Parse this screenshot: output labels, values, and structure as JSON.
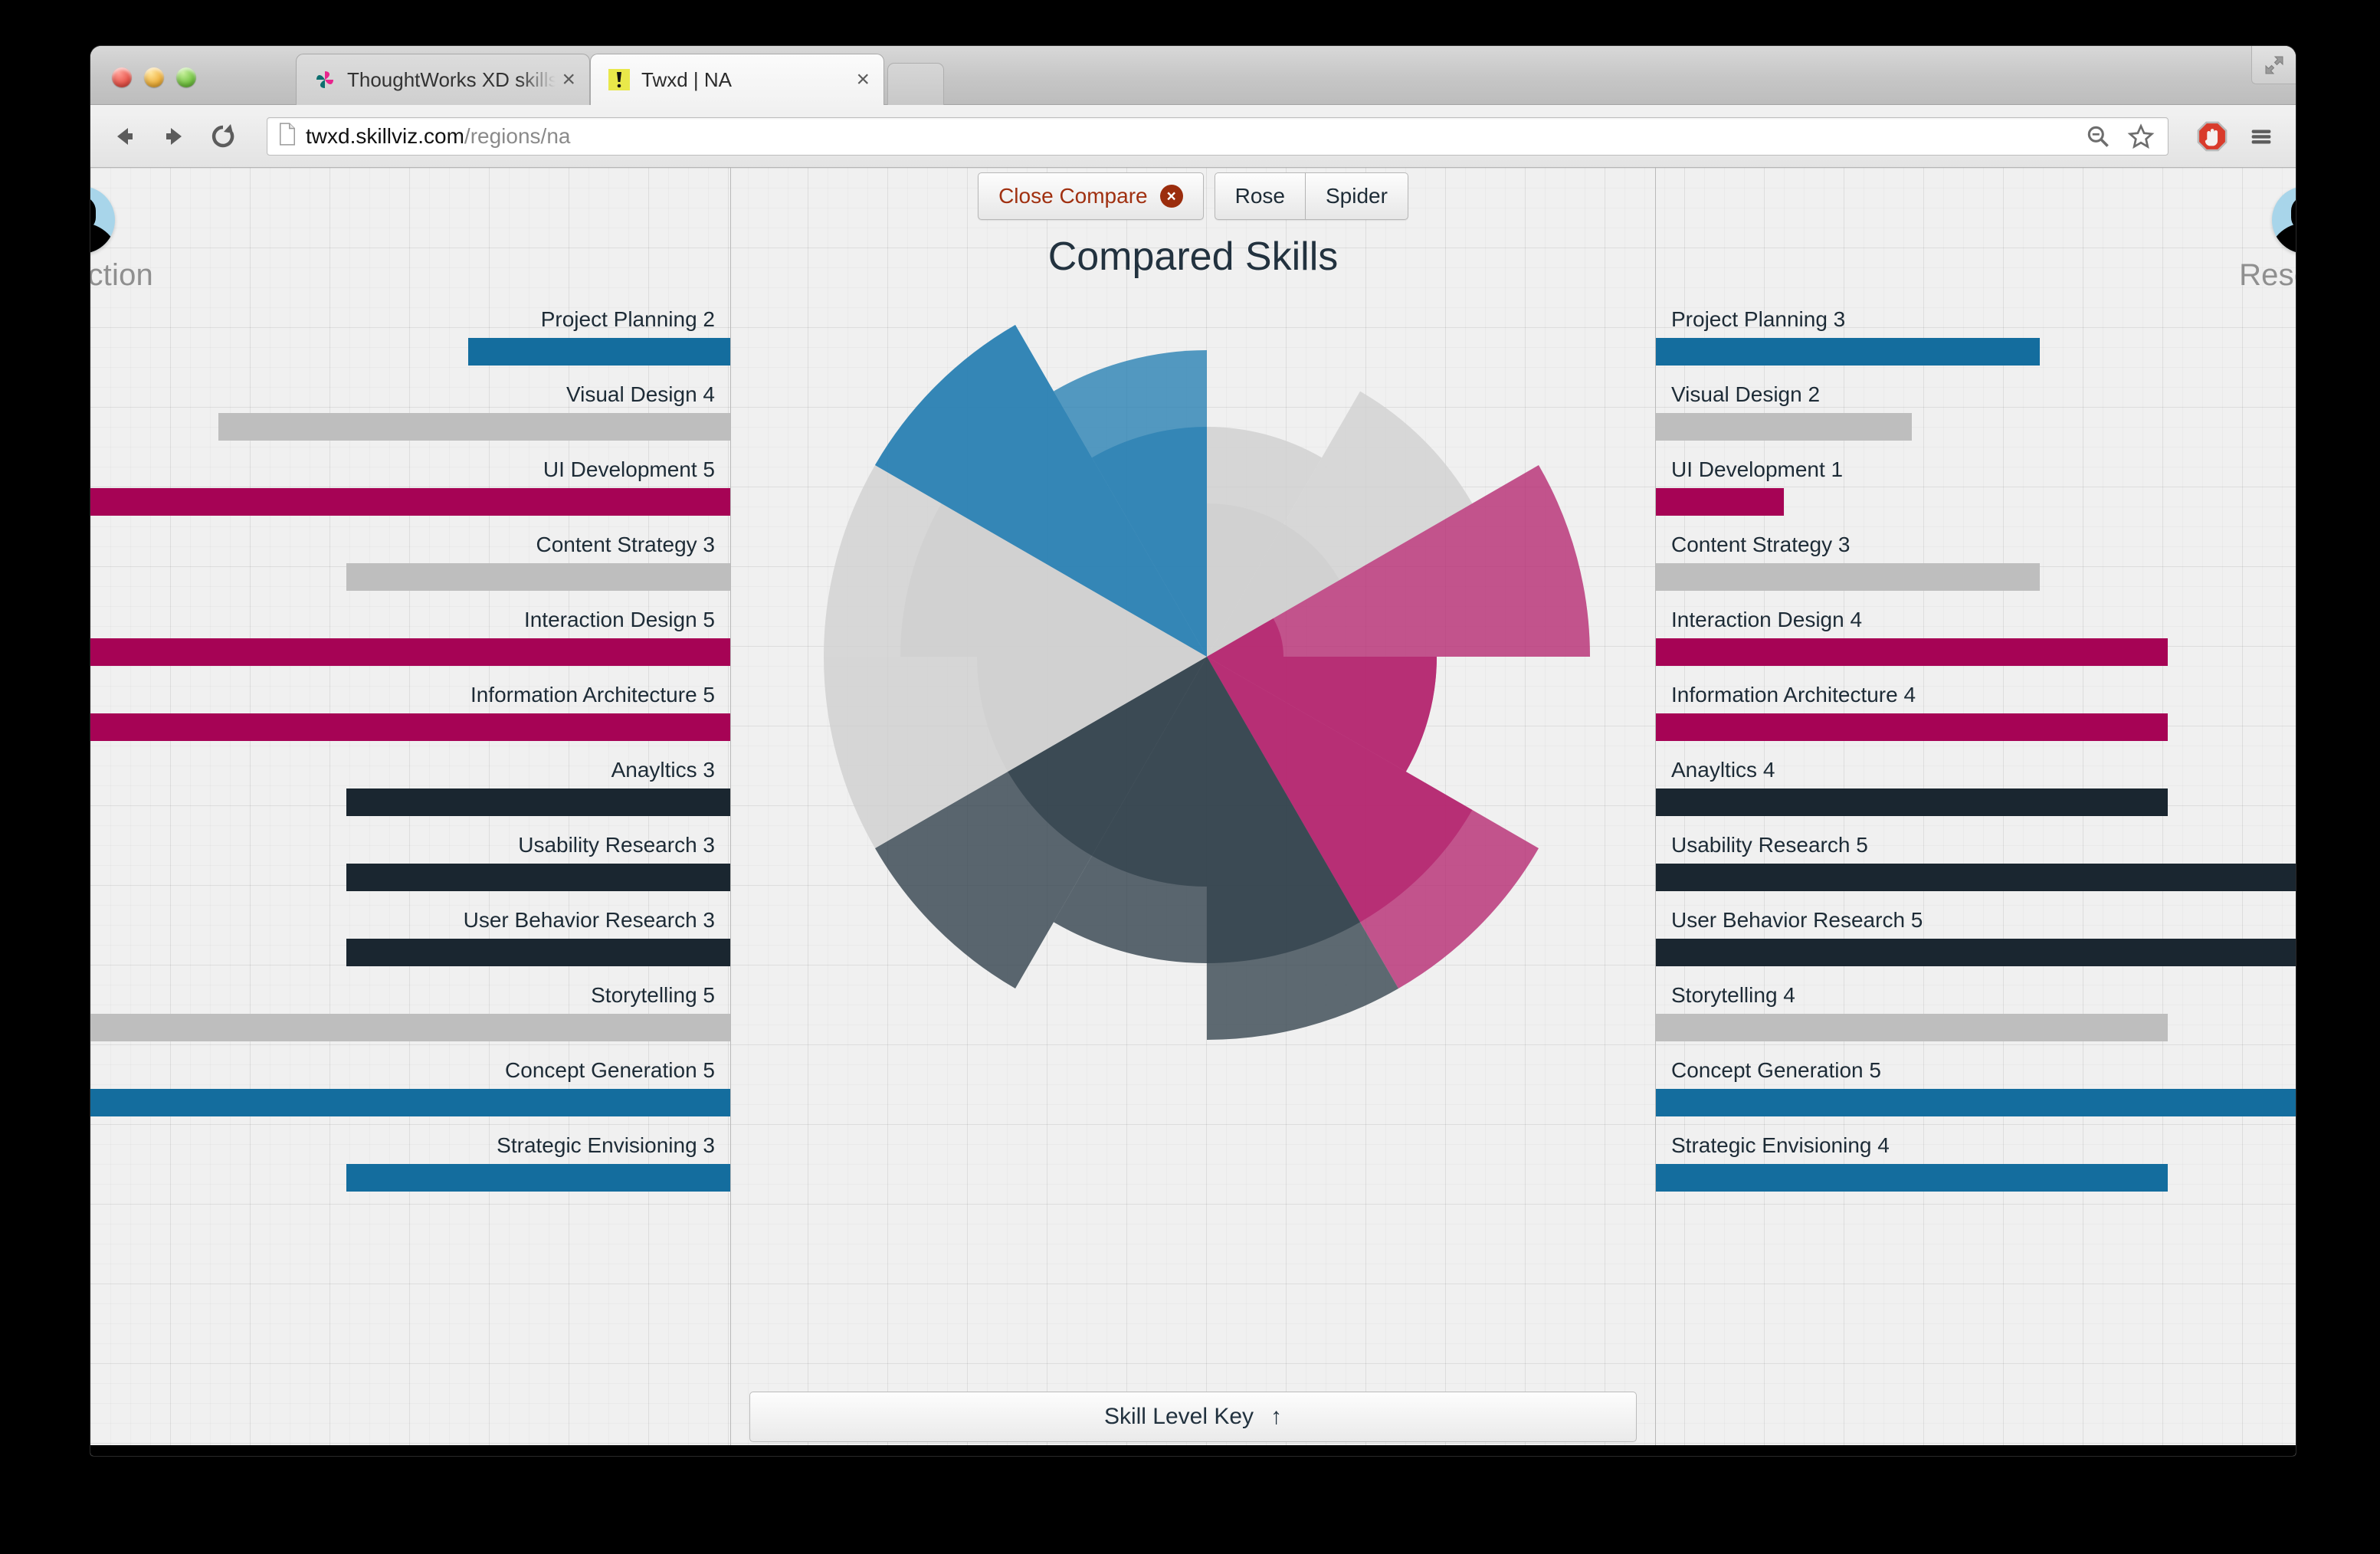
{
  "browser": {
    "tabs": [
      {
        "title": "ThoughtWorks XD skills vis",
        "favicon": "pinwheel-icon",
        "active": false,
        "close_label": "×"
      },
      {
        "title": "Twxd | NA",
        "favicon": "warning-icon",
        "active": true,
        "close_label": "×"
      }
    ],
    "new_tab_label": "",
    "nav": {
      "back": "←",
      "forward": "→",
      "reload": "⟳"
    },
    "url": {
      "domain": "twxd.skillviz.com",
      "path": "/regions/na"
    },
    "toolbar_icons": [
      "zoom-out-icon",
      "bookmark-star-icon",
      "adblock-icon",
      "chrome-menu-icon"
    ],
    "window_buttons": [
      "close",
      "minimize",
      "zoom"
    ],
    "maximize_label": "maximize-icon"
  },
  "center": {
    "close_compare_label": "Close Compare",
    "close_compare_badge": "×",
    "view_toggle": [
      {
        "label": "Rose",
        "selected": true
      },
      {
        "label": "Spider",
        "selected": false
      }
    ],
    "title": "Compared Skills",
    "skill_key_label": "Skill Level Key",
    "skill_key_arrow": "↑"
  },
  "colors": {
    "blue": "#146d9e",
    "magenta": "#a60355",
    "gray": "#bebebe",
    "dark": "#1a2630",
    "rose_blue": "#2b82b4",
    "rose_magenta": "#b5266f",
    "rose_gray": "#cfcfcf",
    "rose_dark": "#33424d",
    "accent_close": "#a03010",
    "avatar_bg": "#a8d5ea"
  },
  "panels": {
    "left": {
      "name": "Interaction",
      "avatar": "user-avatar-icon",
      "align": "right",
      "skills": [
        {
          "name": "Project Planning",
          "value": 2,
          "color": "blue",
          "frac": 0.41
        },
        {
          "name": "Visual Design",
          "value": 4,
          "color": "gray",
          "frac": 0.8
        },
        {
          "name": "UI Development",
          "value": 5,
          "color": "magenta",
          "frac": 1.0
        },
        {
          "name": "Content Strategy",
          "value": 3,
          "color": "gray",
          "frac": 0.6
        },
        {
          "name": "Interaction Design",
          "value": 5,
          "color": "magenta",
          "frac": 1.0
        },
        {
          "name": "Information Architecture",
          "value": 5,
          "color": "magenta",
          "frac": 1.0
        },
        {
          "name": "Anayltics",
          "value": 3,
          "color": "dark",
          "frac": 0.6
        },
        {
          "name": "Usability Research",
          "value": 3,
          "color": "dark",
          "frac": 0.6
        },
        {
          "name": "User Behavior Research",
          "value": 3,
          "color": "dark",
          "frac": 0.6
        },
        {
          "name": "Storytelling",
          "value": 5,
          "color": "gray",
          "frac": 1.0
        },
        {
          "name": "Concept Generation",
          "value": 5,
          "color": "blue",
          "frac": 1.0
        },
        {
          "name": "Strategic Envisioning",
          "value": 3,
          "color": "blue",
          "frac": 0.6
        }
      ]
    },
    "right": {
      "name": "Research",
      "avatar": "user-avatar-icon",
      "align": "left",
      "skills": [
        {
          "name": "Project Planning",
          "value": 3,
          "color": "blue",
          "frac": 0.6
        },
        {
          "name": "Visual Design",
          "value": 2,
          "color": "gray",
          "frac": 0.4
        },
        {
          "name": "UI Development",
          "value": 1,
          "color": "magenta",
          "frac": 0.2
        },
        {
          "name": "Content Strategy",
          "value": 3,
          "color": "gray",
          "frac": 0.6
        },
        {
          "name": "Interaction Design",
          "value": 4,
          "color": "magenta",
          "frac": 0.8
        },
        {
          "name": "Information Architecture",
          "value": 4,
          "color": "magenta",
          "frac": 0.8
        },
        {
          "name": "Anayltics",
          "value": 4,
          "color": "dark",
          "frac": 0.8
        },
        {
          "name": "Usability Research",
          "value": 5,
          "color": "dark",
          "frac": 1.0
        },
        {
          "name": "User Behavior Research",
          "value": 5,
          "color": "dark",
          "frac": 1.0
        },
        {
          "name": "Storytelling",
          "value": 4,
          "color": "gray",
          "frac": 0.8
        },
        {
          "name": "Concept Generation",
          "value": 5,
          "color": "blue",
          "frac": 1.0
        },
        {
          "name": "Strategic Envisioning",
          "value": 4,
          "color": "blue",
          "frac": 0.8
        }
      ]
    }
  },
  "chart_data": {
    "type": "pie",
    "subtype": "rose / polar-area (nightingale), two overlaid series",
    "title": "Compared Skills",
    "categories": [
      "Project Planning",
      "Visual Design",
      "UI Development",
      "Content Strategy",
      "Interaction Design",
      "Information Architecture",
      "Anayltics",
      "Usability Research",
      "User Behavior Research",
      "Storytelling",
      "Concept Generation",
      "Strategic Envisioning"
    ],
    "value_range": [
      0,
      5
    ],
    "wedge_angle_deg": 30,
    "start_angle_deg": -90,
    "series": [
      {
        "name": "Interaction",
        "values": [
          2,
          4,
          5,
          3,
          5,
          5,
          3,
          3,
          3,
          5,
          5,
          3
        ]
      },
      {
        "name": "Research",
        "values": [
          3,
          2,
          1,
          3,
          4,
          4,
          4,
          5,
          5,
          4,
          5,
          4
        ]
      }
    ],
    "slice_colors": [
      "gray",
      "gray",
      "magenta",
      "magenta",
      "magenta",
      "dark",
      "dark",
      "dark",
      "gray",
      "gray",
      "blue",
      "blue"
    ],
    "legend": {
      "position": "none"
    },
    "grid": true
  }
}
